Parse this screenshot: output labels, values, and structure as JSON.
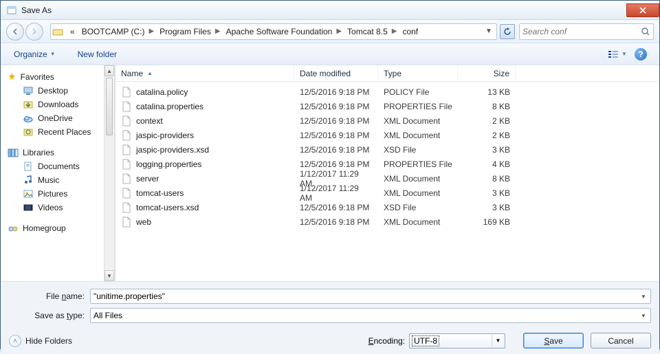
{
  "title": "Save As",
  "breadcrumb": {
    "lead_glyph": "«",
    "segments": [
      "BOOTCAMP (C:)",
      "Program Files",
      "Apache Software Foundation",
      "Tomcat 8.5",
      "conf"
    ]
  },
  "search": {
    "placeholder": "Search conf"
  },
  "toolbar": {
    "organize": "Organize",
    "newfolder": "New folder"
  },
  "tree": {
    "favorites": {
      "label": "Favorites",
      "items": [
        {
          "icon": "desktop",
          "label": "Desktop"
        },
        {
          "icon": "downloads",
          "label": "Downloads"
        },
        {
          "icon": "onedrive",
          "label": "OneDrive"
        },
        {
          "icon": "recent",
          "label": "Recent Places"
        }
      ]
    },
    "libraries": {
      "label": "Libraries",
      "items": [
        {
          "icon": "docs",
          "label": "Documents"
        },
        {
          "icon": "music",
          "label": "Music"
        },
        {
          "icon": "pics",
          "label": "Pictures"
        },
        {
          "icon": "videos",
          "label": "Videos"
        }
      ]
    },
    "homegroup": {
      "label": "Homegroup"
    }
  },
  "columns": {
    "name": "Name",
    "date": "Date modified",
    "type": "Type",
    "size": "Size"
  },
  "files": [
    {
      "name": "catalina.policy",
      "date": "12/5/2016 9:18 PM",
      "type": "POLICY File",
      "size": "13 KB"
    },
    {
      "name": "catalina.properties",
      "date": "12/5/2016 9:18 PM",
      "type": "PROPERTIES File",
      "size": "8 KB"
    },
    {
      "name": "context",
      "date": "12/5/2016 9:18 PM",
      "type": "XML Document",
      "size": "2 KB"
    },
    {
      "name": "jaspic-providers",
      "date": "12/5/2016 9:18 PM",
      "type": "XML Document",
      "size": "2 KB"
    },
    {
      "name": "jaspic-providers.xsd",
      "date": "12/5/2016 9:18 PM",
      "type": "XSD File",
      "size": "3 KB"
    },
    {
      "name": "logging.properties",
      "date": "12/5/2016 9:18 PM",
      "type": "PROPERTIES File",
      "size": "4 KB"
    },
    {
      "name": "server",
      "date": "1/12/2017 11:29 AM",
      "type": "XML Document",
      "size": "8 KB"
    },
    {
      "name": "tomcat-users",
      "date": "1/12/2017 11:29 AM",
      "type": "XML Document",
      "size": "3 KB"
    },
    {
      "name": "tomcat-users.xsd",
      "date": "12/5/2016 9:18 PM",
      "type": "XSD File",
      "size": "3 KB"
    },
    {
      "name": "web",
      "date": "12/5/2016 9:18 PM",
      "type": "XML Document",
      "size": "169 KB"
    }
  ],
  "form": {
    "filename_label": "File name:",
    "filename_value": "\"unitime.properties\"",
    "saveas_label": "Save as type:",
    "saveas_value": "All Files",
    "encoding_label": "Encoding:",
    "encoding_value": "UTF-8",
    "save": "Save",
    "cancel": "Cancel",
    "hide_folders": "Hide Folders"
  }
}
